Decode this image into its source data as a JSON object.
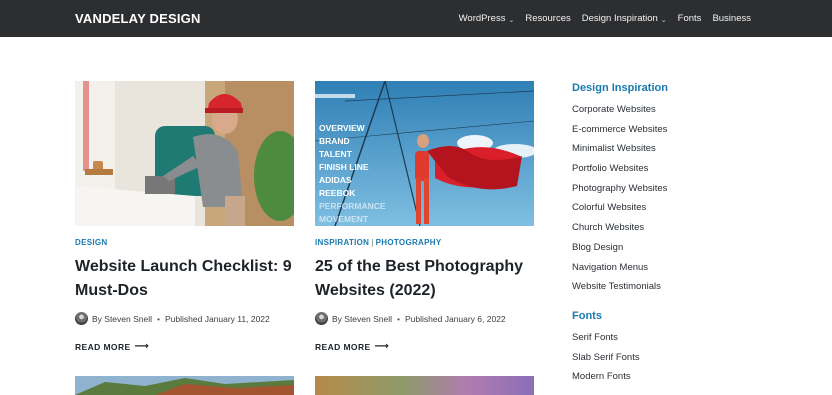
{
  "site": {
    "logo": "VANDELAY DESIGN"
  },
  "nav": {
    "items": [
      {
        "label": "WordPress",
        "dropdown": true
      },
      {
        "label": "Resources",
        "dropdown": false
      },
      {
        "label": "Design Inspiration",
        "dropdown": true
      },
      {
        "label": "Fonts",
        "dropdown": false
      },
      {
        "label": "Business",
        "dropdown": false
      }
    ]
  },
  "posts": [
    {
      "categories": [
        "DESIGN"
      ],
      "title": "Website Launch Checklist: 9 Must-Dos",
      "author": "By Steven Snell",
      "published": "Published January 11, 2022",
      "read_more": "READ MORE",
      "image": "woman-laptop-cafe"
    },
    {
      "categories": [
        "INSPIRATION",
        "PHOTOGRAPHY"
      ],
      "title": "25 of the Best Photography Websites (2022)",
      "author": "By Steven Snell",
      "published": "Published January 6, 2022",
      "read_more": "READ MORE",
      "image": "woman-red-fabric",
      "overlay_words": [
        "OVERVIEW",
        "BRAND",
        "TALENT",
        "FINISH LINE",
        "ADIDAS",
        "REEBOK",
        "PERFORMANCE",
        "MOVEMENT"
      ]
    }
  ],
  "sidebar": {
    "section1": {
      "title": "Design Inspiration",
      "items": [
        "Corporate Websites",
        "E-commerce Websites",
        "Minimalist Websites",
        "Portfolio Websites",
        "Photography Websites",
        "Colorful Websites",
        "Church Websites",
        "Blog Design",
        "Navigation Menus",
        "Website Testimonials"
      ]
    },
    "section2": {
      "title": "Fonts",
      "items": [
        "Serif Fonts",
        "Slab Serif Fonts",
        "Modern Fonts"
      ]
    }
  },
  "colors": {
    "header_bg": "#2d2e30",
    "accent": "#1a7ab0",
    "text": "#1d2329"
  },
  "icons": {
    "chevron": "chevron-down-icon",
    "arrow": "arrow-right-icon",
    "avatar": "author-avatar"
  }
}
